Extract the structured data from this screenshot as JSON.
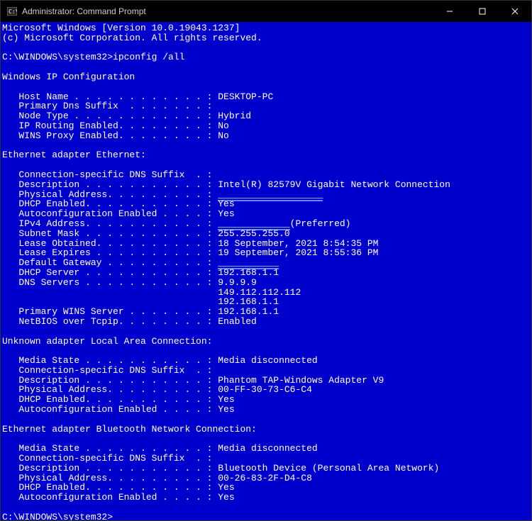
{
  "titlebar": {
    "title": "Administrator: Command Prompt"
  },
  "banner": {
    "line1": "Microsoft Windows [Version 10.0.19043.1237]",
    "line2": "(c) Microsoft Corporation. All rights reserved."
  },
  "prompt1": {
    "path": "C:\\WINDOWS\\system32>",
    "cmd": "ipconfig /all"
  },
  "header": "Windows IP Configuration",
  "host": {
    "host_name_label": "   Host Name . . . . . . . . . . . . : ",
    "host_name": "DESKTOP-PC",
    "dns_suffix_label": "   Primary Dns Suffix  . . . . . . . :",
    "node_type_label": "   Node Type . . . . . . . . . . . . : ",
    "node_type": "Hybrid",
    "ip_routing_label": "   IP Routing Enabled. . . . . . . . : ",
    "ip_routing": "No",
    "wins_proxy_label": "   WINS Proxy Enabled. . . . . . . . : ",
    "wins_proxy": "No"
  },
  "eth": {
    "title": "Ethernet adapter Ethernet:",
    "conn_dns_label": "   Connection-specific DNS Suffix  . :",
    "desc_label": "   Description . . . . . . . . . . . : ",
    "desc": "Intel(R) 82579V Gigabit Network Connection",
    "phys_label": "   Physical Address. . . . . . . . . : ",
    "phys_redacted": "XX-XX-XX-XX-XX-XX  ",
    "dhcp_en_label": "   DHCP Enabled. . . . . . . . . . . : ",
    "dhcp_en": "Yes",
    "auto_label": "   Autoconfiguration Enabled . . . . : ",
    "auto": "Yes",
    "ipv4_label": "   IPv4 Address. . . . . . . . . . . : ",
    "ipv4_redacted": "XXX.XXX.X.XXX",
    "ipv4_suffix": "(Preferred)",
    "subnet_label": "   Subnet Mask . . . . . . . . . . . : ",
    "subnet": "255.255.255.0",
    "lease_obt_label": "   Lease Obtained. . . . . . . . . . : ",
    "lease_obt": "18 September, 2021 8:54:35 PM",
    "lease_exp_label": "   Lease Expires . . . . . . . . . . : ",
    "lease_exp": "19 September, 2021 8:55:36 PM",
    "gateway_label": "   Default Gateway . . . . . . . . . : ",
    "gateway_redacted": "XXX.XXX.X.X",
    "dhcp_srv_label": "   DHCP Server . . . . . . . . . . . : ",
    "dhcp_srv": "192.168.1.1",
    "dns_label": "   DNS Servers . . . . . . . . . . . : ",
    "dns1": "9.9.9.9",
    "dns2_pad": "                                       ",
    "dns2": "149.112.112.112",
    "dns3_pad": "                                       ",
    "dns3": "192.168.1.1",
    "wins_label": "   Primary WINS Server . . . . . . . : ",
    "wins": "192.168.1.1",
    "netbios_label": "   NetBIOS over Tcpip. . . . . . . . : ",
    "netbios": "Enabled"
  },
  "lac": {
    "title": "Unknown adapter Local Area Connection:",
    "media_label": "   Media State . . . . . . . . . . . : ",
    "media": "Media disconnected",
    "conn_dns_label": "   Connection-specific DNS Suffix  . :",
    "desc_label": "   Description . . . . . . . . . . . : ",
    "desc": "Phantom TAP-Windows Adapter V9",
    "phys_label": "   Physical Address. . . . . . . . . : ",
    "phys": "00-FF-30-73-C6-C4",
    "dhcp_en_label": "   DHCP Enabled. . . . . . . . . . . : ",
    "dhcp_en": "Yes",
    "auto_label": "   Autoconfiguration Enabled . . . . : ",
    "auto": "Yes"
  },
  "bt": {
    "title": "Ethernet adapter Bluetooth Network Connection:",
    "media_label": "   Media State . . . . . . . . . . . : ",
    "media": "Media disconnected",
    "conn_dns_label": "   Connection-specific DNS Suffix  . :",
    "desc_label": "   Description . . . . . . . . . . . : ",
    "desc": "Bluetooth Device (Personal Area Network)",
    "phys_label": "   Physical Address. . . . . . . . . : ",
    "phys": "00-26-83-2F-D4-C8",
    "dhcp_en_label": "   DHCP Enabled. . . . . . . . . . . : ",
    "dhcp_en": "Yes",
    "auto_label": "   Autoconfiguration Enabled . . . . : ",
    "auto": "Yes"
  },
  "prompt2": {
    "path": "C:\\WINDOWS\\system32>"
  }
}
